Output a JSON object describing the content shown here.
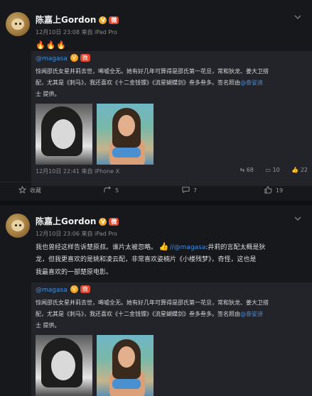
{
  "posts": [
    {
      "author": "陈嘉上Gordon",
      "meta": "12月10日 23:08 来自 iPad Pro",
      "emojis": "🔥🔥🔥",
      "repost": {
        "mention": "@magasa",
        "text1": "惊闻邵氏女星井莉去世，唏嘘全无。她有好几年可算得是邵氏第一花旦，常和狄龙、姜大卫搭",
        "text2": "配，尤其是《刺马》，我还喜欢《十二金钱镖》《流星蝴蝶剑》叁多叁多。签名照由",
        "link1": "@奋娑迪",
        "text3": "士 提供。",
        "meta": "12月10日 22:41 来自 iPhone X",
        "reposts": "68",
        "comments": "10",
        "likes": "22"
      },
      "actions": {
        "forward": "收藏",
        "repost_count": "5",
        "comment_count": "7",
        "like_count": "19"
      }
    },
    {
      "author": "陈嘉上Gordon",
      "meta": "12月10日 23:06 来自 iPad Pro",
      "text1": "我也曾经这样告诉楚原叔。谁片太被忽略。",
      "mention": "//@magasa",
      "text1b": ":井莉的言配太概是狄",
      "text2": "龙，但我更喜欢的是姚和凌云配，非常喜欢姿楠片《小楼残梦》，奇怪，这也是",
      "text3": "我最喜欢的一部楚原电影。",
      "repost": {
        "mention": "@magasa",
        "text1": "惊闻邵氏女星井莉去世，唏嘘全无。她有好几年可算得是邵氏第一花旦，常和狄龙、姜大卫搭",
        "text2": "配，尤其是《刺马》，我还喜欢《十二金钱镖》《流星蝴蝶剑》叁多叁多。签名照由",
        "link1": "@奋娑迪",
        "text3": "士 提供。"
      }
    }
  ]
}
